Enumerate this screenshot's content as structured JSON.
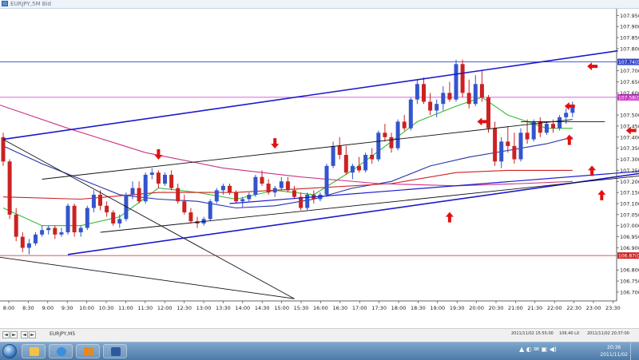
{
  "window": {
    "title": "EURJPY,5M Bid"
  },
  "chart_data": {
    "type": "candlestick",
    "title": "",
    "symbol_tab": "EURJPY,M5",
    "ylim": [
      106.66,
      107.98
    ],
    "y_ticks": [
      {
        "value": 107.95,
        "label": "107.95(0"
      },
      {
        "value": 107.9,
        "label": "107.90(0"
      },
      {
        "value": 107.85,
        "label": "107.85(0"
      },
      {
        "value": 107.8,
        "label": "107.80(0"
      },
      {
        "value": 107.7,
        "label": "107.70(0"
      },
      {
        "value": 107.65,
        "label": "107.65(0"
      },
      {
        "value": 107.6,
        "label": "107.60(0"
      },
      {
        "value": 107.5,
        "label": "107.50(0"
      },
      {
        "value": 107.45,
        "label": "107.45(0"
      },
      {
        "value": 107.4,
        "label": "107.40(0"
      },
      {
        "value": 107.35,
        "label": "107.35(0"
      },
      {
        "value": 107.3,
        "label": "107.30(0"
      },
      {
        "value": 107.25,
        "label": "107.25(0"
      },
      {
        "value": 107.2,
        "label": "107.20(0"
      },
      {
        "value": 107.15,
        "label": "107.15(0"
      },
      {
        "value": 107.1,
        "label": "107.10(0"
      },
      {
        "value": 107.05,
        "label": "107.05(0"
      },
      {
        "value": 107.0,
        "label": "107.00(0"
      },
      {
        "value": 106.95,
        "label": "106.95(0"
      },
      {
        "value": 106.9,
        "label": "106.90(0"
      },
      {
        "value": 106.8,
        "label": "106.80(0"
      },
      {
        "value": 106.75,
        "label": "106.75(0"
      },
      {
        "value": 106.7,
        "label": "106.70(0"
      }
    ],
    "x_ticks": [
      "8:00",
      "8:30",
      "9:00",
      "9:30",
      "10:00",
      "10:30",
      "11:00",
      "11:30",
      "12:00",
      "12:30",
      "13:00",
      "13:30",
      "14:00",
      "14:30",
      "15:00",
      "15:30",
      "16:00",
      "16:30",
      "17:00",
      "17:30",
      "18:00",
      "18:30",
      "19:00",
      "19:30",
      "20:00",
      "20:30",
      "21:00",
      "21:30",
      "22:00",
      "22:30",
      "23:00",
      "23:30"
    ],
    "x_start": "8:00",
    "price_lines": [
      {
        "value": 107.74,
        "label": "107.74(0",
        "color": "#3344cc"
      },
      {
        "value": 107.58,
        "label": "107.58(0",
        "color": "#cc33cc"
      },
      {
        "value": 106.865,
        "label": "106.87(0",
        "color": "#cc2222"
      }
    ],
    "candles": [
      [
        107.4,
        107.42,
        107.27,
        107.29
      ],
      [
        107.29,
        107.3,
        107.03,
        107.05
      ],
      [
        107.05,
        107.08,
        106.93,
        106.95
      ],
      [
        106.95,
        106.97,
        106.88,
        106.9
      ],
      [
        106.9,
        106.94,
        106.87,
        106.92
      ],
      [
        106.92,
        106.97,
        106.91,
        106.96
      ],
      [
        106.96,
        107.0,
        106.95,
        106.98
      ],
      [
        106.98,
        107.0,
        106.96,
        106.99
      ],
      [
        106.99,
        107.0,
        106.94,
        106.96
      ],
      [
        106.96,
        106.99,
        106.95,
        106.97
      ],
      [
        106.97,
        107.1,
        106.96,
        107.09
      ],
      [
        107.09,
        107.1,
        106.95,
        106.97
      ],
      [
        106.97,
        107.0,
        106.95,
        106.99
      ],
      [
        106.99,
        107.09,
        106.98,
        107.08
      ],
      [
        107.08,
        107.16,
        107.06,
        107.14
      ],
      [
        107.14,
        107.16,
        107.07,
        107.09
      ],
      [
        107.09,
        107.11,
        107.04,
        107.06
      ],
      [
        107.06,
        107.07,
        107.0,
        107.01
      ],
      [
        107.01,
        107.05,
        106.99,
        107.03
      ],
      [
        107.03,
        107.15,
        107.02,
        107.14
      ],
      [
        107.14,
        107.2,
        107.12,
        107.17
      ],
      [
        107.17,
        107.2,
        107.1,
        107.11
      ],
      [
        107.11,
        107.24,
        107.1,
        107.23
      ],
      [
        107.23,
        107.26,
        107.21,
        107.24
      ],
      [
        107.24,
        107.25,
        107.17,
        107.19
      ],
      [
        107.19,
        107.24,
        107.18,
        107.23
      ],
      [
        107.23,
        107.25,
        107.16,
        107.17
      ],
      [
        107.17,
        107.19,
        107.1,
        107.11
      ],
      [
        107.11,
        107.14,
        107.05,
        107.06
      ],
      [
        107.06,
        107.08,
        107.01,
        107.02
      ],
      [
        107.02,
        107.04,
        106.99,
        107.01
      ],
      [
        107.01,
        107.04,
        107.0,
        107.03
      ],
      [
        107.03,
        107.12,
        107.02,
        107.11
      ],
      [
        107.11,
        107.17,
        107.1,
        107.16
      ],
      [
        107.16,
        107.19,
        107.14,
        107.18
      ],
      [
        107.18,
        107.19,
        107.14,
        107.15
      ],
      [
        107.15,
        107.16,
        107.1,
        107.11
      ],
      [
        107.11,
        107.13,
        107.08,
        107.12
      ],
      [
        107.12,
        107.15,
        107.11,
        107.14
      ],
      [
        107.14,
        107.23,
        107.13,
        107.22
      ],
      [
        107.22,
        107.25,
        107.18,
        107.19
      ],
      [
        107.19,
        107.21,
        107.14,
        107.15
      ],
      [
        107.15,
        107.18,
        107.13,
        107.17
      ],
      [
        107.17,
        107.22,
        107.16,
        107.2
      ],
      [
        107.2,
        107.22,
        107.15,
        107.16
      ],
      [
        107.16,
        107.18,
        107.12,
        107.13
      ],
      [
        107.13,
        107.15,
        107.07,
        107.08
      ],
      [
        107.08,
        107.15,
        107.07,
        107.14
      ],
      [
        107.14,
        107.16,
        107.1,
        107.12
      ],
      [
        107.12,
        107.15,
        107.11,
        107.14
      ],
      [
        107.14,
        107.28,
        107.13,
        107.27
      ],
      [
        107.27,
        107.38,
        107.26,
        107.36
      ],
      [
        107.36,
        107.4,
        107.3,
        107.32
      ],
      [
        107.32,
        107.36,
        107.23,
        107.24
      ],
      [
        107.24,
        107.28,
        107.21,
        107.27
      ],
      [
        107.27,
        107.31,
        107.24,
        107.25
      ],
      [
        107.25,
        107.33,
        107.24,
        107.32
      ],
      [
        107.32,
        107.35,
        107.28,
        107.3
      ],
      [
        107.3,
        107.43,
        107.29,
        107.42
      ],
      [
        107.42,
        107.46,
        107.38,
        107.4
      ],
      [
        107.4,
        107.42,
        107.33,
        107.35
      ],
      [
        107.35,
        107.48,
        107.34,
        107.47
      ],
      [
        107.47,
        107.5,
        107.43,
        107.44
      ],
      [
        107.44,
        107.58,
        107.43,
        107.57
      ],
      [
        107.57,
        107.66,
        107.55,
        107.64
      ],
      [
        107.64,
        107.67,
        107.55,
        107.56
      ],
      [
        107.56,
        107.6,
        107.5,
        107.52
      ],
      [
        107.52,
        107.57,
        107.49,
        107.55
      ],
      [
        107.55,
        107.63,
        107.52,
        107.6
      ],
      [
        107.6,
        107.65,
        107.56,
        107.57
      ],
      [
        107.57,
        107.75,
        107.56,
        107.73
      ],
      [
        107.73,
        107.75,
        107.58,
        107.6
      ],
      [
        107.6,
        107.66,
        107.53,
        107.55
      ],
      [
        107.55,
        107.68,
        107.54,
        107.64
      ],
      [
        107.64,
        107.7,
        107.56,
        107.58
      ],
      [
        107.58,
        107.59,
        107.42,
        107.44
      ],
      [
        107.44,
        107.47,
        107.27,
        107.29
      ],
      [
        107.29,
        107.4,
        107.26,
        107.38
      ],
      [
        107.38,
        107.45,
        107.33,
        107.36
      ],
      [
        107.36,
        107.42,
        107.28,
        107.3
      ],
      [
        107.3,
        107.44,
        107.29,
        107.42
      ],
      [
        107.42,
        107.48,
        107.37,
        107.39
      ],
      [
        107.39,
        107.48,
        107.38,
        107.47
      ],
      [
        107.47,
        107.49,
        107.4,
        107.42
      ],
      [
        107.42,
        107.47,
        107.41,
        107.46
      ],
      [
        107.46,
        107.48,
        107.42,
        107.44
      ],
      [
        107.44,
        107.5,
        107.43,
        107.49
      ],
      [
        107.49,
        107.53,
        107.46,
        107.51
      ],
      [
        107.51,
        107.56,
        107.49,
        107.54
      ]
    ],
    "indicators": [
      {
        "color": "#33bb33",
        "points": [
          [
            0,
            107.08
          ],
          [
            6,
            107.0
          ],
          [
            12,
            107.0
          ],
          [
            18,
            107.04
          ],
          [
            24,
            107.17
          ],
          [
            30,
            107.15
          ],
          [
            36,
            107.12
          ],
          [
            42,
            107.16
          ],
          [
            48,
            107.14
          ],
          [
            54,
            107.25
          ],
          [
            60,
            107.38
          ],
          [
            64,
            107.47
          ],
          [
            70,
            107.54
          ],
          [
            74,
            107.58
          ],
          [
            78,
            107.5
          ],
          [
            84,
            107.44
          ],
          [
            88,
            107.44
          ]
        ]
      },
      {
        "color": "#2233aa",
        "points": [
          [
            0,
            107.36
          ],
          [
            6,
            107.28
          ],
          [
            12,
            107.21
          ],
          [
            18,
            107.14
          ],
          [
            24,
            107.12
          ],
          [
            30,
            107.11
          ],
          [
            36,
            107.08
          ],
          [
            42,
            107.09
          ],
          [
            48,
            107.12
          ],
          [
            54,
            107.17
          ],
          [
            60,
            107.2
          ],
          [
            66,
            107.27
          ],
          [
            72,
            107.31
          ],
          [
            78,
            107.34
          ],
          [
            84,
            107.37
          ],
          [
            88,
            107.4
          ]
        ]
      },
      {
        "color": "#cc2222",
        "points": [
          [
            0,
            107.13
          ],
          [
            12,
            107.12
          ],
          [
            24,
            107.15
          ],
          [
            36,
            107.15
          ],
          [
            48,
            107.17
          ],
          [
            60,
            107.19
          ],
          [
            70,
            107.24
          ],
          [
            78,
            107.25
          ],
          [
            88,
            107.25
          ]
        ]
      },
      {
        "color": "#cc3388",
        "points": [
          [
            -2,
            107.56
          ],
          [
            10,
            107.44
          ],
          [
            22,
            107.33
          ],
          [
            34,
            107.26
          ],
          [
            46,
            107.22
          ],
          [
            58,
            107.19
          ],
          [
            70,
            107.18
          ],
          [
            80,
            107.19
          ],
          [
            88,
            107.2
          ]
        ]
      }
    ],
    "trendlines": [
      {
        "color": "#1a1acc",
        "width": 1.6,
        "from": [
          0,
          107.39
        ],
        "to": [
          95,
          107.79
        ]
      },
      {
        "color": "#1a1acc",
        "width": 1.6,
        "from": [
          10,
          106.87
        ],
        "to": [
          109,
          107.28
        ]
      },
      {
        "color": "#1a1acc",
        "width": 1.2,
        "from": [
          35,
          107.1
        ],
        "to": [
          109,
          107.27
        ]
      },
      {
        "color": "#111111",
        "width": 0.9,
        "from": [
          0,
          107.39
        ],
        "to": [
          45,
          106.67
        ]
      },
      {
        "color": "#111111",
        "width": 0.9,
        "from": [
          6,
          107.21
        ],
        "to": [
          88,
          107.48
        ]
      },
      {
        "color": "#111111",
        "width": 0.9,
        "from": [
          15,
          106.97
        ],
        "to": [
          100,
          107.23
        ]
      },
      {
        "color": "#111111",
        "width": 0.9,
        "from": [
          -6,
          106.88
        ],
        "to": [
          45,
          106.67
        ]
      },
      {
        "color": "#111111",
        "width": 0.9,
        "from": [
          80,
          107.47
        ],
        "to": [
          93,
          107.47
        ]
      }
    ],
    "arrows": [
      {
        "dir": "down",
        "x": 24,
        "y": 107.32
      },
      {
        "dir": "down",
        "x": 42,
        "y": 107.37
      },
      {
        "dir": "up",
        "x": 69,
        "y": 107.04
      },
      {
        "dir": "left",
        "x": 74,
        "y": 107.47
      },
      {
        "dir": "left",
        "x": 91,
        "y": 107.72
      },
      {
        "dir": "left",
        "x": 87.5,
        "y": 107.54
      },
      {
        "dir": "up",
        "x": 87.5,
        "y": 107.39
      },
      {
        "dir": "up",
        "x": 91,
        "y": 107.25
      },
      {
        "dir": "up",
        "x": 92.5,
        "y": 107.14
      },
      {
        "dir": "left",
        "x": 97,
        "y": 107.43
      },
      {
        "dir": "down",
        "x": 100,
        "y": 107.55
      },
      {
        "dir": "left",
        "x": 108,
        "y": 107.49
      }
    ],
    "grid": false,
    "colors": {
      "bull": "#3355cc",
      "bear": "#cc2222",
      "axis": "#333333"
    }
  },
  "statusbar": {
    "symbol": "EURJPY,M5",
    "time1": "2011/11/02 15:55:00",
    "time2": "106.40 LX",
    "time3": "2011/11/02 20:37:00",
    "nav": [
      "◄",
      "►",
      "◄",
      "►"
    ]
  },
  "taskbar": {
    "time": "20:36",
    "date": "2011/11/02",
    "tray": "▲ ◐ ✉ ▣ ◀)"
  }
}
